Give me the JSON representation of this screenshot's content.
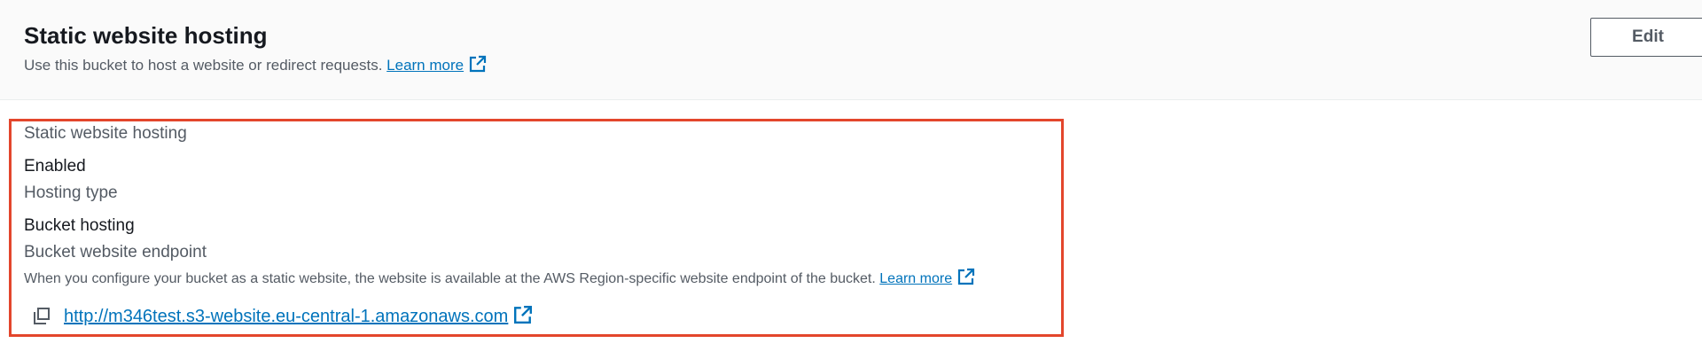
{
  "header": {
    "title": "Static website hosting",
    "description": "Use this bucket to host a website or redirect requests.",
    "learn_more": "Learn more",
    "edit_label": "Edit"
  },
  "details": {
    "hosting_label": "Static website hosting",
    "hosting_value": "Enabled",
    "type_label": "Hosting type",
    "type_value": "Bucket hosting",
    "endpoint_label": "Bucket website endpoint",
    "endpoint_description": "When you configure your bucket as a static website, the website is available at the AWS Region-specific website endpoint of the bucket.",
    "endpoint_learn_more": "Learn more",
    "endpoint_url": "http://m346test.s3-website.eu-central-1.amazonaws.com"
  },
  "icons": {
    "external": "external-link-icon",
    "copy": "copy-icon"
  },
  "colors": {
    "link": "#0073bb",
    "highlight": "#e3462c",
    "header_bg": "#fafafa",
    "text_secondary": "#545b64"
  }
}
